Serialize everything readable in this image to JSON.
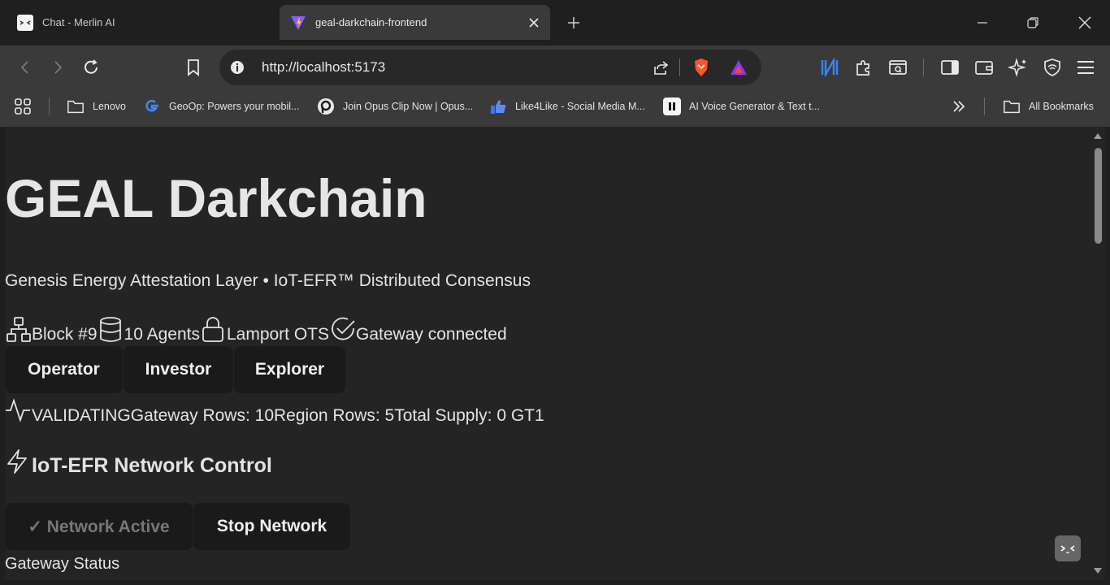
{
  "browser": {
    "tabs": [
      {
        "title": "Chat - Merlin AI",
        "icon": "merlin-icon",
        "active": false
      },
      {
        "title": "geal-darkchain-frontend",
        "icon": "vite-icon",
        "active": true
      }
    ],
    "url": "http://localhost:5173",
    "bookmarks": [
      {
        "label": "Lenovo",
        "icon": "folder-icon"
      },
      {
        "label": "GeoOp: Powers your mobil...",
        "icon": "google-icon"
      },
      {
        "label": "Join Opus Clip Now | Opus...",
        "icon": "opus-icon"
      },
      {
        "label": "Like4Like - Social Media M...",
        "icon": "thumbs-up-icon"
      },
      {
        "label": "AI Voice Generator & Text t...",
        "icon": "pause-icon"
      }
    ],
    "all_bookmarks": "All Bookmarks"
  },
  "page": {
    "title": "GEAL Darkchain",
    "subtitle": "Genesis Energy Attestation Layer • IoT-EFR™ Distributed Consensus",
    "status": {
      "block": "Block #9",
      "agents": "10 Agents",
      "signature": "Lamport OTS",
      "gateway": "Gateway connected"
    },
    "roles": [
      "Operator",
      "Investor",
      "Explorer"
    ],
    "metrics": {
      "state": "VALIDATING",
      "gateway_rows": "Gateway Rows: 10",
      "region_rows": "Region Rows: 5",
      "total_supply": "Total Supply: 0 GT1"
    },
    "section_title": "IoT-EFR Network Control",
    "network_buttons": {
      "active": "✓ Network Active",
      "stop": "Stop Network"
    },
    "gateway_status_label": "Gateway Status"
  }
}
